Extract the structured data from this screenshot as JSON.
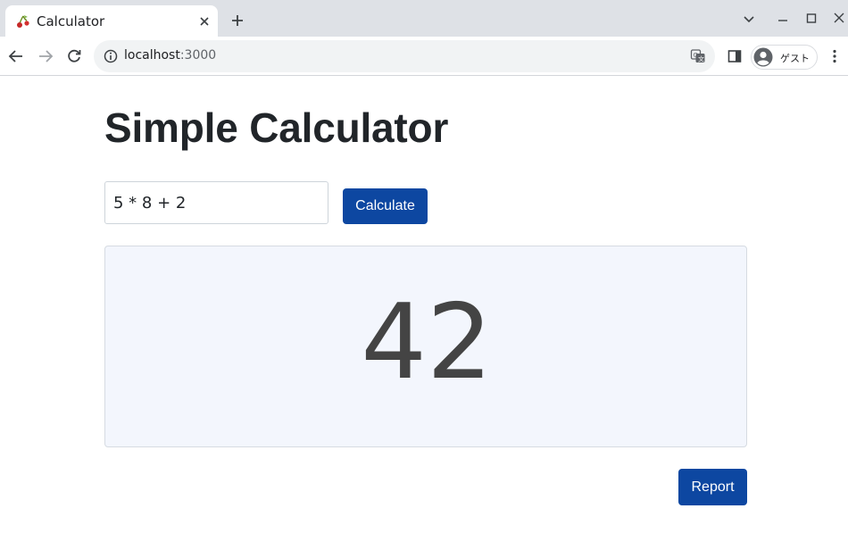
{
  "browser": {
    "tab_title": "Calculator",
    "url_host": "localhost",
    "url_port": ":3000",
    "profile_label": "ゲスト"
  },
  "page": {
    "title": "Simple Calculator",
    "expression_value": "5 * 8 + 2",
    "calculate_label": "Calculate",
    "result": "42",
    "report_label": "Report"
  },
  "colors": {
    "primary_button": "#0d47a1",
    "result_background": "#f3f6fd",
    "tabstrip": "#dee1e6"
  }
}
